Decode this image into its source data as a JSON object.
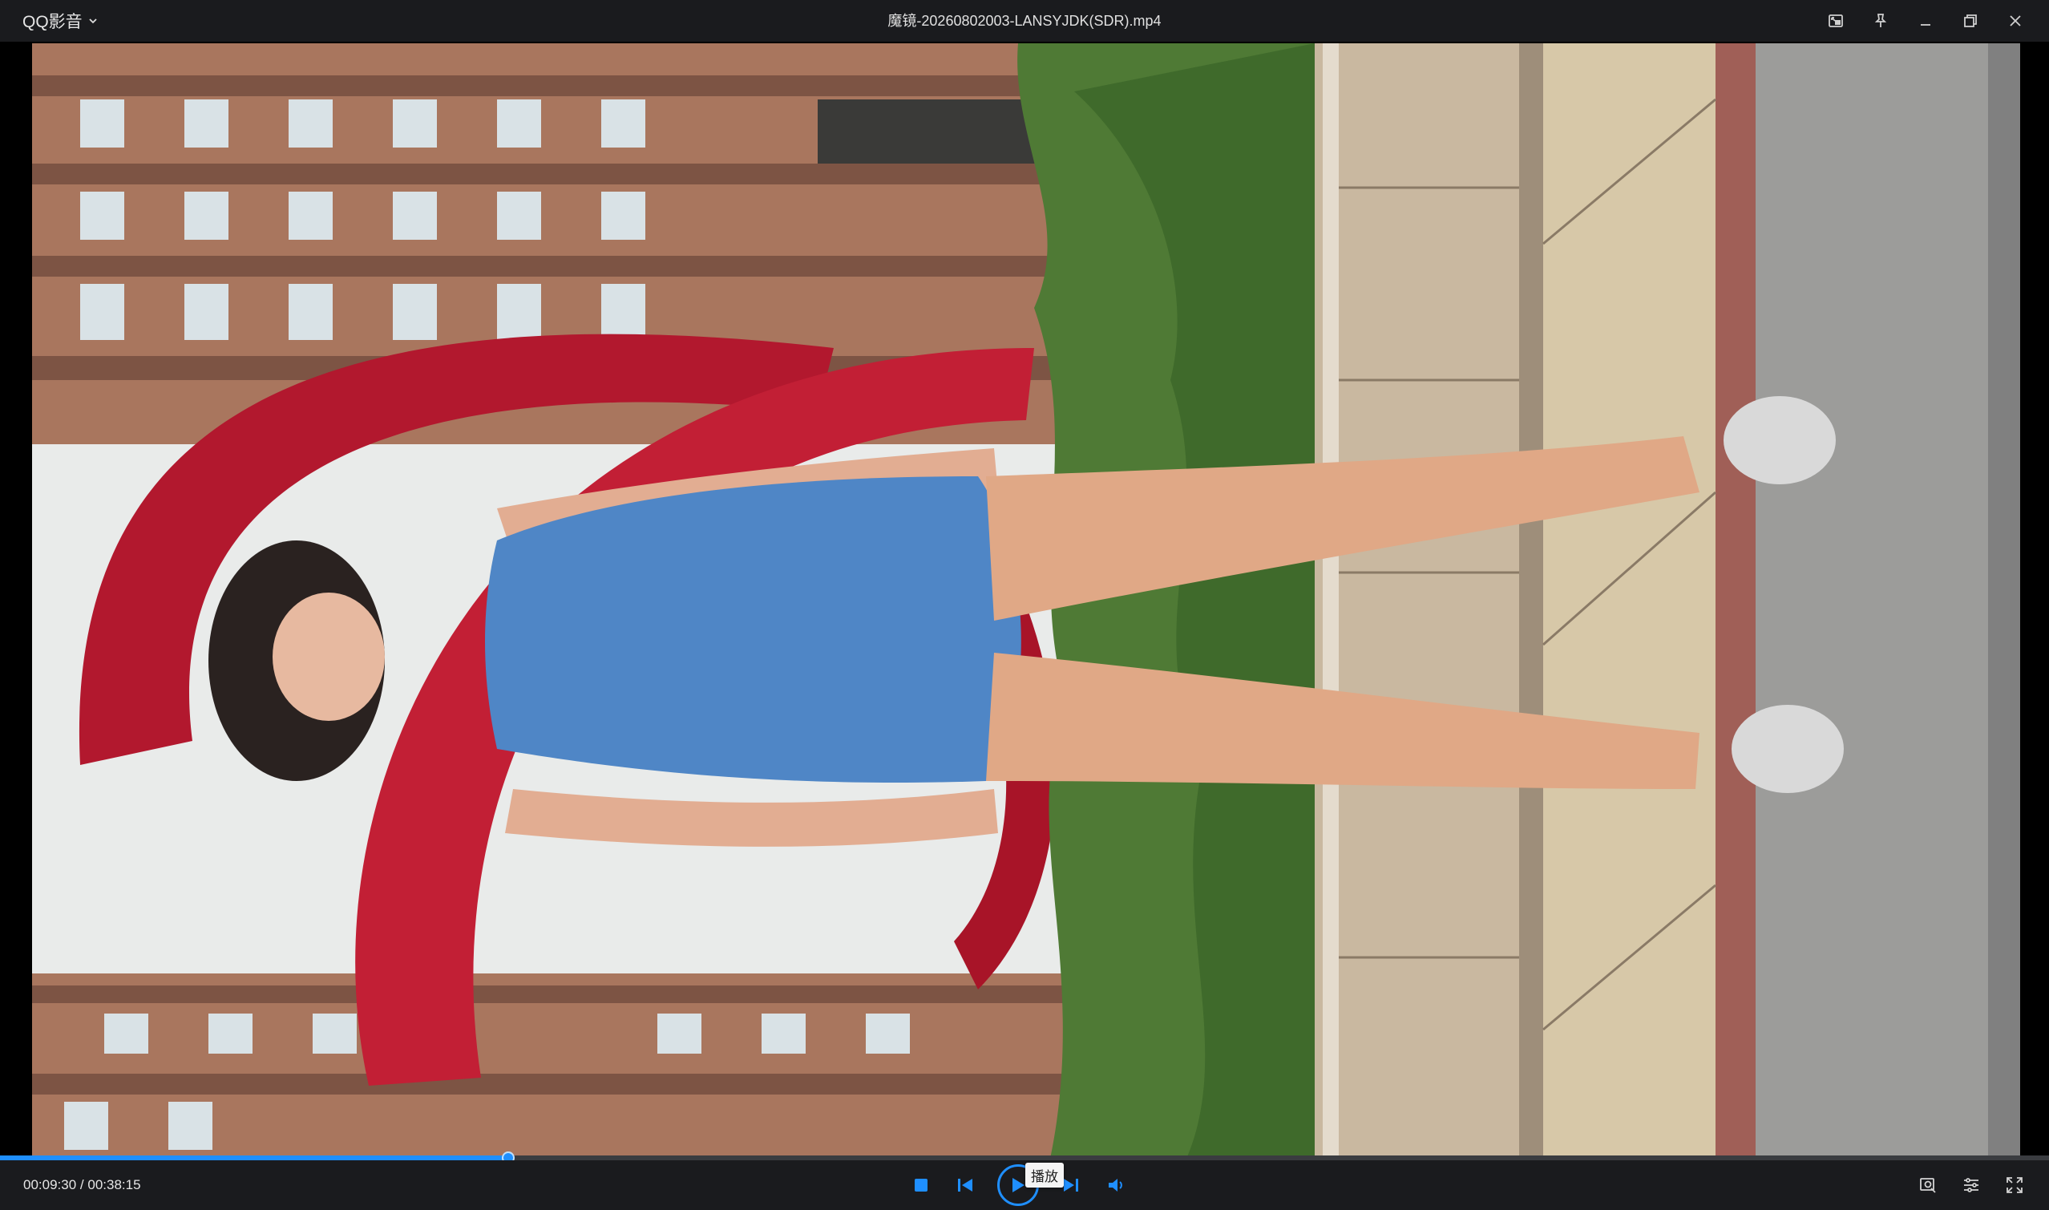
{
  "titlebar": {
    "app_name": "QQ影音",
    "file_title": "魔镜-20260802003-LANSYJDK(SDR).mp4",
    "icons": [
      "picture-in-picture-icon",
      "pin-icon",
      "minimize-icon",
      "restore-icon",
      "close-icon"
    ]
  },
  "playback": {
    "current_time": "00:09:30",
    "separator": " / ",
    "total_time": "00:38:15",
    "progress_fraction": 0.248,
    "tooltip": "播放"
  },
  "controls": {
    "center_icons": [
      "stop-icon",
      "previous-icon",
      "play-icon",
      "next-icon",
      "volume-icon"
    ],
    "right_icons": [
      "screenshot-icon",
      "settings-icon",
      "fullscreen-icon"
    ]
  },
  "colors": {
    "accent": "#1f8fff",
    "bar_background": "#1a1b1e",
    "progress_track": "#3a3c40"
  }
}
